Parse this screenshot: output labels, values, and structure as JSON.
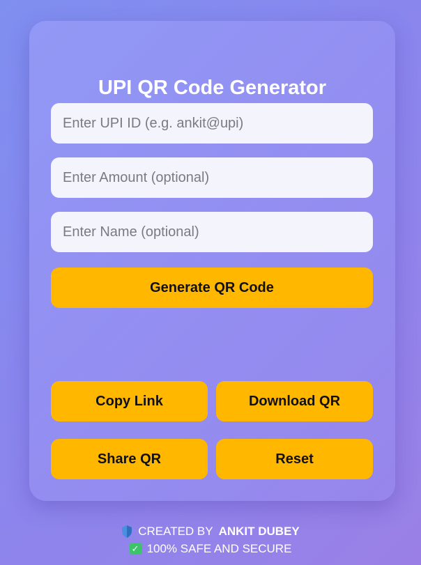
{
  "app": {
    "title": "UPI QR Code Generator"
  },
  "form": {
    "upi_placeholder": "Enter UPI ID (e.g. ankit@upi)",
    "amount_placeholder": "Enter Amount (optional)",
    "name_placeholder": "Enter Name (optional)",
    "generate_label": "Generate QR Code"
  },
  "actions": {
    "copy_label": "Copy Link",
    "download_label": "Download QR",
    "share_label": "Share QR",
    "reset_label": "Reset"
  },
  "footer": {
    "created_prefix": "CREATED BY",
    "author": "ANKIT DUBEY",
    "safe_text": "100% SAFE AND SECURE",
    "shield_icon": "shield-icon",
    "check_icon": "check-icon"
  },
  "colors": {
    "accent": "#ffb700",
    "input_bg": "#f4f4fc",
    "title_text": "#ffffff"
  }
}
